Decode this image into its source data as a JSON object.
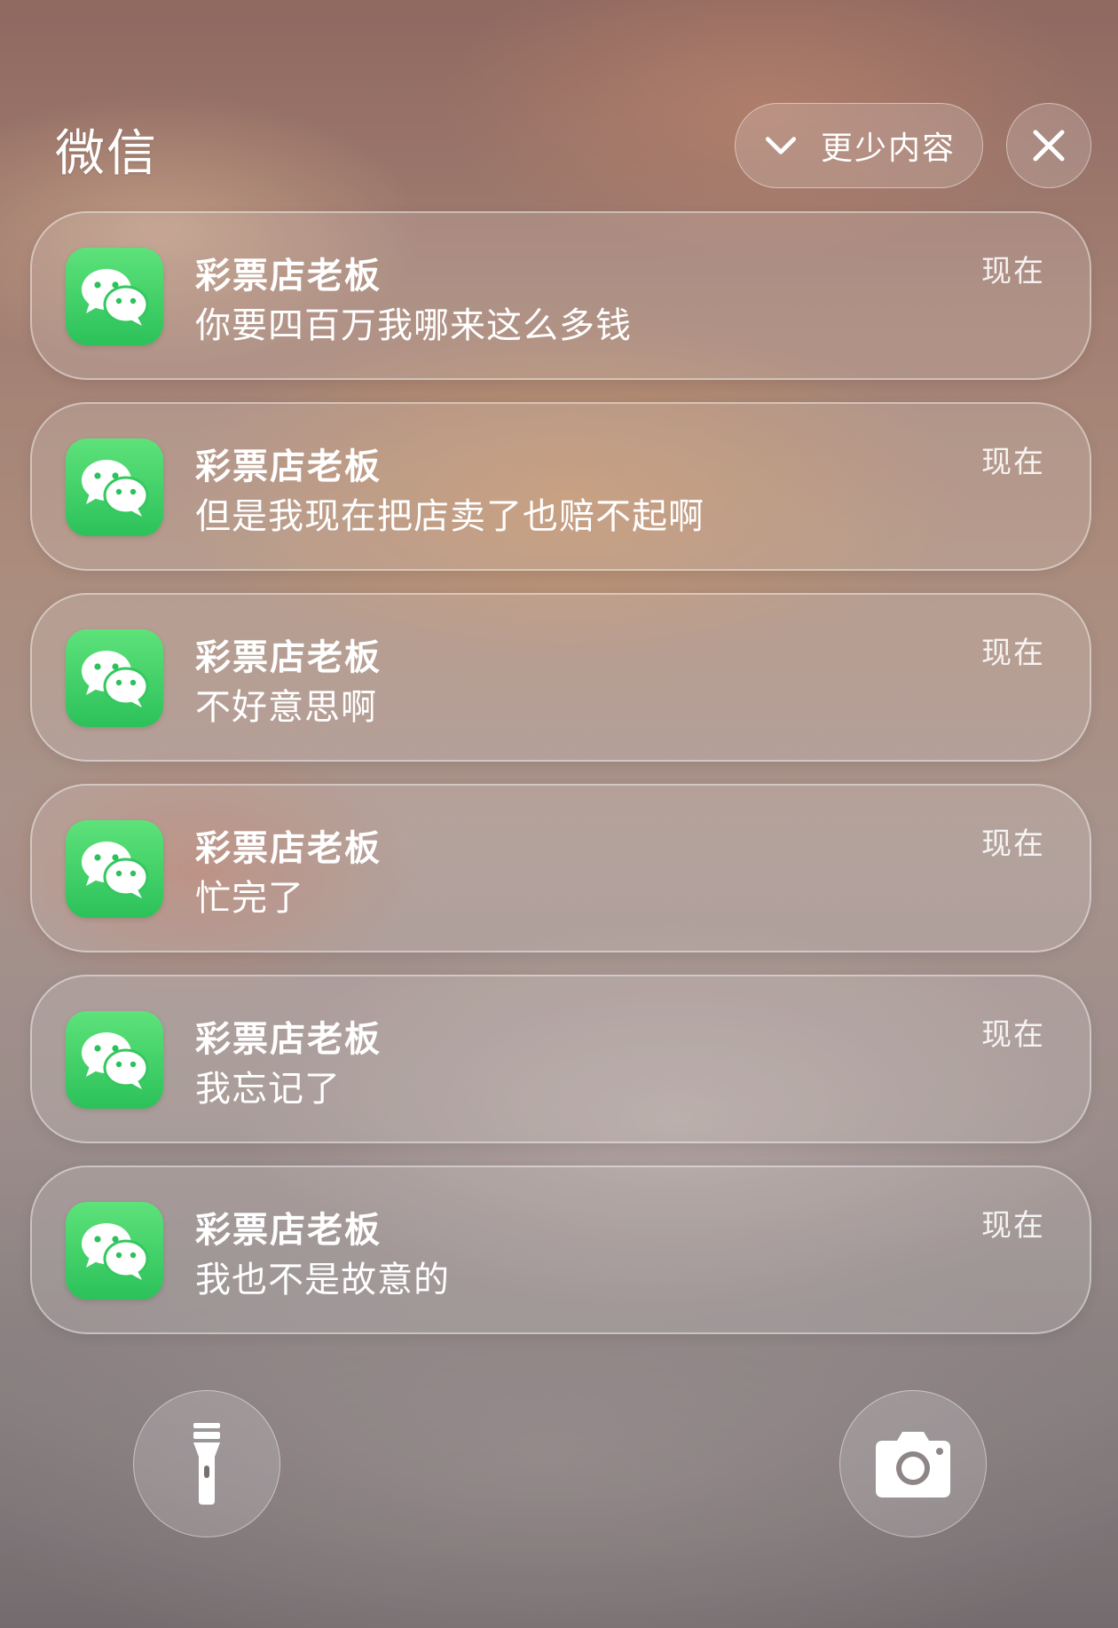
{
  "header": {
    "app_name": "微信",
    "less_button_label": "更少内容"
  },
  "icons": {
    "less_chevron": "chevron-down-icon",
    "close": "close-icon",
    "app": "wechat-icon",
    "flashlight": "flashlight-icon",
    "camera": "camera-icon"
  },
  "colors": {
    "wechat_green": "#2cc15a"
  },
  "notifications": [
    {
      "sender": "彩票店老板",
      "message": "你要四百万我哪来这么多钱",
      "time": "现在"
    },
    {
      "sender": "彩票店老板",
      "message": "但是我现在把店卖了也赔不起啊",
      "time": "现在"
    },
    {
      "sender": "彩票店老板",
      "message": "不好意思啊",
      "time": "现在"
    },
    {
      "sender": "彩票店老板",
      "message": "忙完了",
      "time": "现在"
    },
    {
      "sender": "彩票店老板",
      "message": "我忘记了",
      "time": "现在"
    },
    {
      "sender": "彩票店老板",
      "message": "我也不是故意的",
      "time": "现在"
    }
  ]
}
